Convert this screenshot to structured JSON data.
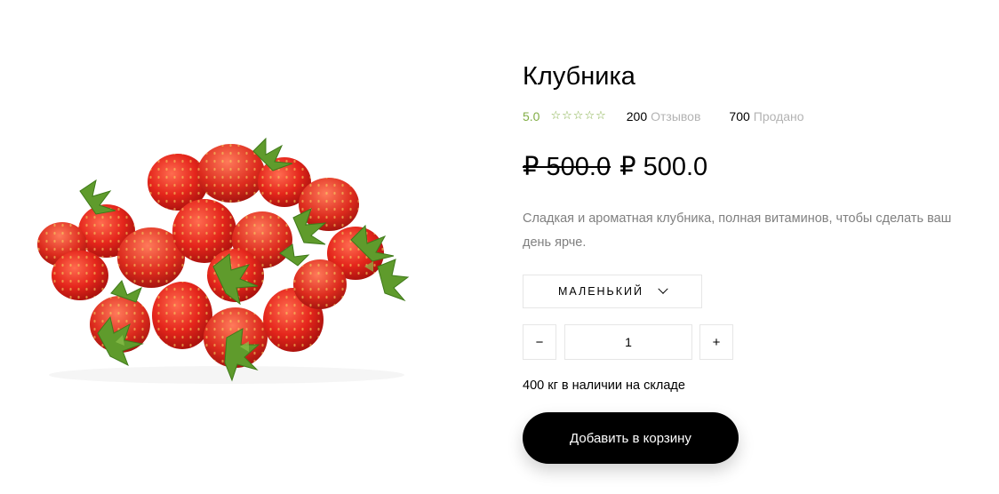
{
  "product": {
    "title": "Клубника",
    "rating": "5.0",
    "stars": [
      "☆",
      "☆",
      "☆",
      "☆",
      "☆"
    ],
    "reviews_count": "200",
    "reviews_label": "Отзывов",
    "sold_count": "700",
    "sold_label": "Продано",
    "old_price": "₽ 500.0",
    "price": "₽ 500.0",
    "description": "Сладкая и ароматная клубника, полная витаминов, чтобы сделать ваш день ярче.",
    "size_selected": "МАЛЕНЬКИЙ",
    "quantity": "1",
    "qty_minus": "−",
    "qty_plus": "+",
    "stock_text": "400 кг в наличии на складе",
    "add_to_cart_label": "Добавить в корзину",
    "image_icon": "strawberries-photo"
  },
  "colors": {
    "accent": "#82ae46",
    "muted": "#b3b3b3",
    "text_secondary": "#808080",
    "border": "#e6e6e6",
    "button_bg": "#000000",
    "button_text": "#ffffff"
  }
}
